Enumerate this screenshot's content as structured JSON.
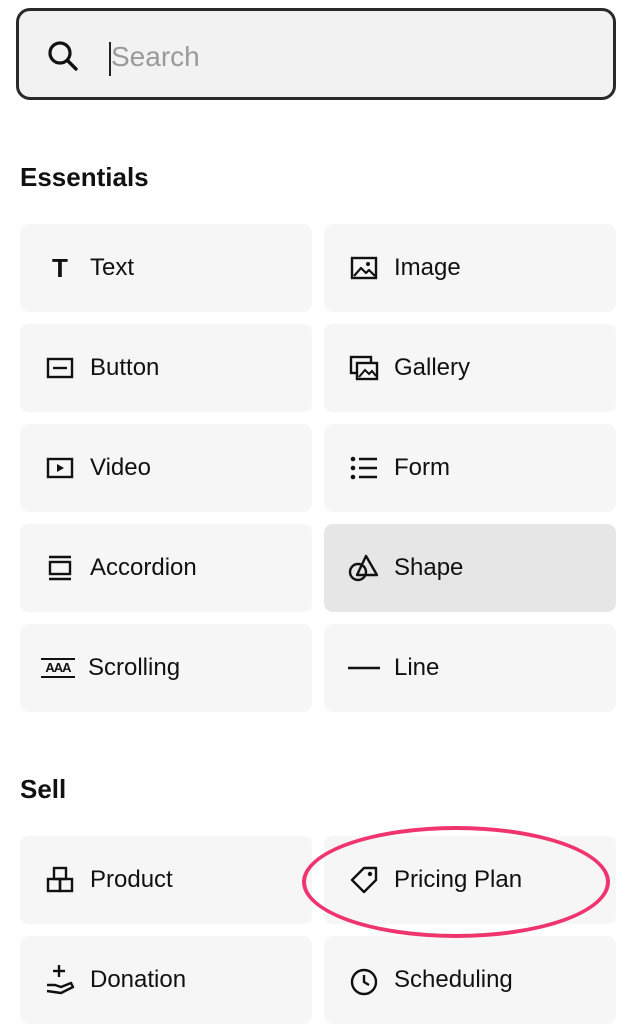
{
  "search": {
    "placeholder": "Search",
    "value": ""
  },
  "sections": [
    {
      "title": "Essentials",
      "items": [
        {
          "label": "Text",
          "icon": "text-icon"
        },
        {
          "label": "Image",
          "icon": "image-icon"
        },
        {
          "label": "Button",
          "icon": "button-icon"
        },
        {
          "label": "Gallery",
          "icon": "gallery-icon"
        },
        {
          "label": "Video",
          "icon": "video-icon"
        },
        {
          "label": "Form",
          "icon": "form-icon"
        },
        {
          "label": "Accordion",
          "icon": "accordion-icon"
        },
        {
          "label": "Shape",
          "icon": "shape-icon",
          "state": "hover"
        },
        {
          "label": "Scrolling",
          "icon": "scrolling-icon"
        },
        {
          "label": "Line",
          "icon": "line-icon"
        }
      ]
    },
    {
      "title": "Sell",
      "items": [
        {
          "label": "Product",
          "icon": "product-icon"
        },
        {
          "label": "Pricing Plan",
          "icon": "tag-icon",
          "annotated": true
        },
        {
          "label": "Donation",
          "icon": "donation-icon"
        },
        {
          "label": "Scheduling",
          "icon": "clock-icon"
        }
      ]
    }
  ],
  "colors": {
    "annotation": "#f0346e",
    "tile": "#f6f6f6",
    "tile_hover": "#e6e6e6",
    "search_bg": "#f2f2f2"
  },
  "icons": {
    "text_glyph": "T",
    "scrolling_glyph": "AAA"
  }
}
